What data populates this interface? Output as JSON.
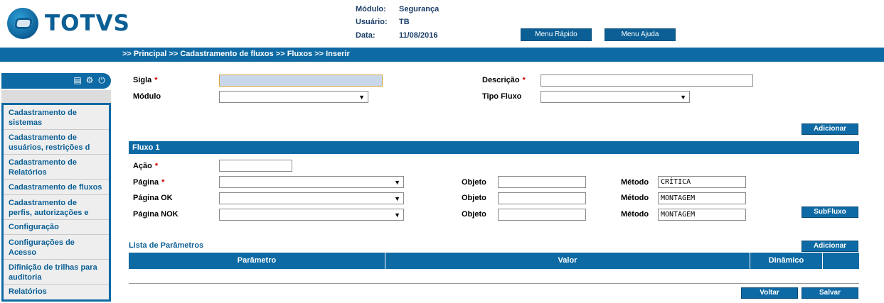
{
  "logo": {
    "text": "TOTVS"
  },
  "header": {
    "modulo_label": "Módulo:",
    "modulo_value": "Segurança",
    "usuario_label": "Usuário:",
    "usuario_value": "TB",
    "data_label": "Data:",
    "data_value": "11/08/2016",
    "menu_rapido": "Menu Rápido",
    "menu_ajuda": "Menu Ajuda"
  },
  "breadcrumb": ">> Principal >> Cadastramento de fluxos >> Fluxos >> Inserir",
  "sidebar": {
    "icons": [
      "document-icon",
      "gear-icon",
      "power-icon"
    ],
    "items": [
      {
        "line1": "Cadastramento de",
        "line2": "sistemas"
      },
      {
        "line1": "Cadastramento de",
        "line2": "usuários, restrições d"
      },
      {
        "line1": "Cadastramento de",
        "line2": "Relatórios"
      },
      {
        "line1": "Cadastramento de fluxos",
        "line2": ""
      },
      {
        "line1": "Cadastramento de",
        "line2": "perfis, autorizações e"
      },
      {
        "line1": "Configuração",
        "line2": ""
      },
      {
        "line1": "Configurações de",
        "line2": "Acesso"
      },
      {
        "line1": "Difinição de trilhas para",
        "line2": "auditoria"
      },
      {
        "line1": "Relatórios",
        "line2": ""
      }
    ]
  },
  "form": {
    "sigla_label": "Sigla",
    "sigla_value": "",
    "descricao_label": "Descrição",
    "descricao_value": "",
    "modulo_label": "Módulo",
    "modulo_value": "",
    "tipo_fluxo_label": "Tipo Fluxo",
    "tipo_fluxo_value": "",
    "required_mark": "*",
    "adicionar_label": "Adicionar"
  },
  "fluxo": {
    "title": "Fluxo 1",
    "acao_label": "Ação",
    "acao_value": "",
    "pagina_label": "Página",
    "pagina_ok_label": "Página OK",
    "pagina_nok_label": "Página NOK",
    "objeto_label": "Objeto",
    "metodo_label": "Método",
    "metodo1_value": "CRÍTICA",
    "metodo2_value": "MONTAGEM",
    "metodo3_value": "MONTAGEM",
    "subfluxo_label": "SubFluxo"
  },
  "parametros": {
    "title": "Lista de Parâmetros",
    "adicionar_label": "Adicionar",
    "columns": [
      "Parâmetro",
      "Valor",
      "Dinâmico"
    ]
  },
  "footer": {
    "voltar_label": "Voltar",
    "salvar_label": "Salvar"
  },
  "colors": {
    "primary": "#0e6aa4",
    "link": "#0b5f95",
    "required": "#cc0000"
  }
}
